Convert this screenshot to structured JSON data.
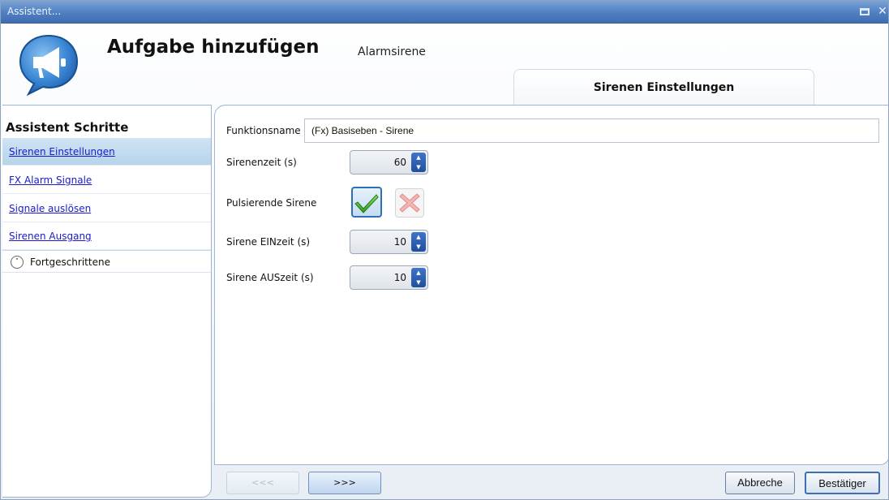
{
  "window": {
    "title": "Assistent..."
  },
  "header": {
    "title": "Aufgabe hinzufügen",
    "subtitle": "Alarmsirene",
    "tab": "Sirenen Einstellungen"
  },
  "sidebar": {
    "title": "Assistent Schritte",
    "items": [
      {
        "label": "Sirenen Einstellungen",
        "active": true
      },
      {
        "label": "FX Alarm Signale",
        "active": false
      },
      {
        "label": "Signale auslösen",
        "active": false
      },
      {
        "label": "Sirenen Ausgang",
        "active": false
      }
    ],
    "advanced": "Fortgeschrittene"
  },
  "form": {
    "function_name_label": "Funktionsname",
    "function_name_value": "(Fx) Basiseben - Sirene",
    "siren_time_label": "Sirenenzeit (s)",
    "siren_time_value": "60",
    "pulsing_label": "Pulsierende Sirene",
    "pulsing_enabled": true,
    "on_time_label": "Sirene EINzeit (s)",
    "on_time_value": "10",
    "off_time_label": "Sirene AUSzeit (s)",
    "off_time_value": "10"
  },
  "footer": {
    "prev_label": "<<<",
    "next_label": ">>>",
    "cancel_label": "Abbreche",
    "confirm_label": "Bestätiger"
  },
  "colors": {
    "titlebar": "#4f7fc0",
    "active_step": "#b7d4ea",
    "link": "#1a1acc",
    "spin_button": "#2a5db0"
  }
}
